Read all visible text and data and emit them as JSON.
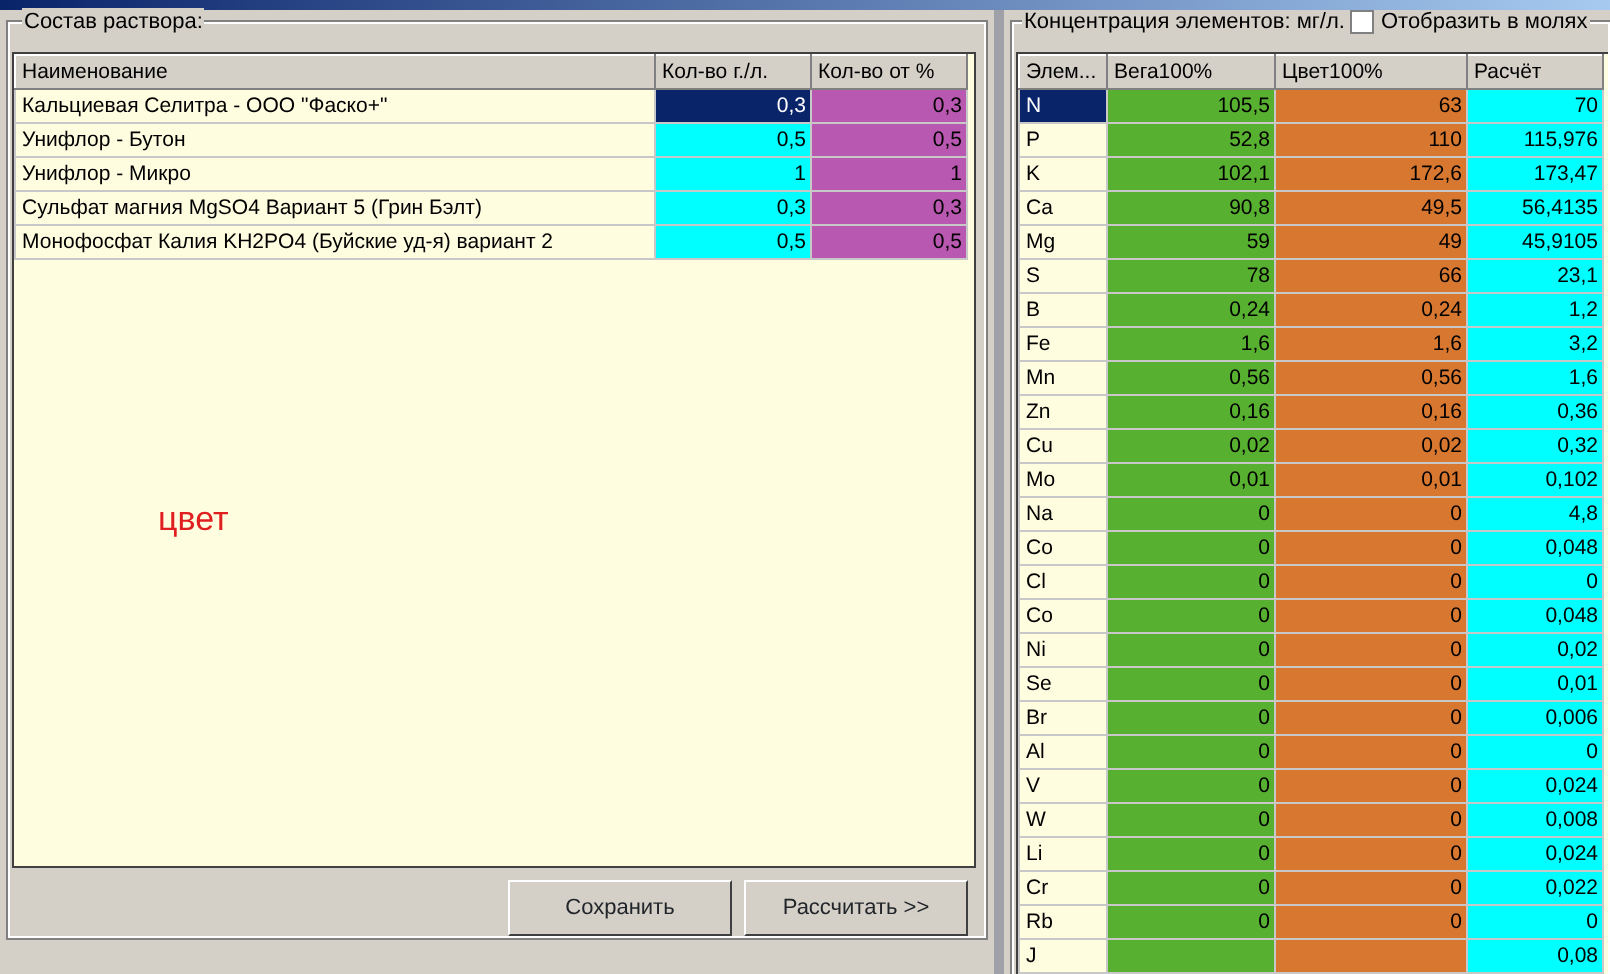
{
  "composition": {
    "title": "Состав раствора:",
    "columns": [
      {
        "label": "Наименование"
      },
      {
        "label": "Кол-во г./л.",
        "color": "#00ffff"
      },
      {
        "label": "Кол-во от %",
        "color": "#b858b0"
      }
    ],
    "rows": [
      {
        "name": "Кальциевая Селитра - ООО \"Фаско+\"",
        "qty": "0,3",
        "pct": "0,3",
        "selected": true
      },
      {
        "name": "Унифлор - Бутон",
        "qty": "0,5",
        "pct": "0,5",
        "selected": false
      },
      {
        "name": "Унифлор - Микро",
        "qty": "1",
        "pct": "1",
        "selected": false
      },
      {
        "name": "Сульфат магния MgSO4 Вариант 5 (Грин Бэлт)",
        "qty": "0,3",
        "pct": "0,3",
        "selected": false
      },
      {
        "name": "Монофосфат Калия KH2PO4 (Буйские уд-я) вариант 2",
        "qty": "0,5",
        "pct": "0,5",
        "selected": false
      }
    ],
    "note": "цвет",
    "buttons": [
      "Сохранить",
      "Рассчитать >>"
    ]
  },
  "concentration": {
    "title": "Концентрация элементов: мг/л.",
    "show_moles": {
      "label": "Отобразить в молях",
      "checked": false
    },
    "columns": [
      {
        "label": "Элем..."
      },
      {
        "label": "Вега100%",
        "color": "#58b030"
      },
      {
        "label": "Цвет100%",
        "color": "#d87830"
      },
      {
        "label": "Расчёт",
        "color": "#00ffff"
      }
    ],
    "rows": [
      {
        "element": "N",
        "vega": "105,5",
        "tsvet": "63",
        "calc": "70",
        "selected": true
      },
      {
        "element": "P",
        "vega": "52,8",
        "tsvet": "110",
        "calc": "115,976",
        "selected": false
      },
      {
        "element": "K",
        "vega": "102,1",
        "tsvet": "172,6",
        "calc": "173,47",
        "selected": false
      },
      {
        "element": "Ca",
        "vega": "90,8",
        "tsvet": "49,5",
        "calc": "56,4135",
        "selected": false
      },
      {
        "element": "Mg",
        "vega": "59",
        "tsvet": "49",
        "calc": "45,9105",
        "selected": false
      },
      {
        "element": "S",
        "vega": "78",
        "tsvet": "66",
        "calc": "23,1",
        "selected": false
      },
      {
        "element": "B",
        "vega": "0,24",
        "tsvet": "0,24",
        "calc": "1,2",
        "selected": false
      },
      {
        "element": "Fe",
        "vega": "1,6",
        "tsvet": "1,6",
        "calc": "3,2",
        "selected": false
      },
      {
        "element": "Mn",
        "vega": "0,56",
        "tsvet": "0,56",
        "calc": "1,6",
        "selected": false
      },
      {
        "element": "Zn",
        "vega": "0,16",
        "tsvet": "0,16",
        "calc": "0,36",
        "selected": false
      },
      {
        "element": "Cu",
        "vega": "0,02",
        "tsvet": "0,02",
        "calc": "0,32",
        "selected": false
      },
      {
        "element": "Mo",
        "vega": "0,01",
        "tsvet": "0,01",
        "calc": "0,102",
        "selected": false
      },
      {
        "element": "Na",
        "vega": "0",
        "tsvet": "0",
        "calc": "4,8",
        "selected": false
      },
      {
        "element": "Co",
        "vega": "0",
        "tsvet": "0",
        "calc": "0,048",
        "selected": false
      },
      {
        "element": "Cl",
        "vega": "0",
        "tsvet": "0",
        "calc": "0",
        "selected": false
      },
      {
        "element": "Co",
        "vega": "0",
        "tsvet": "0",
        "calc": "0,048",
        "selected": false
      },
      {
        "element": "Ni",
        "vega": "0",
        "tsvet": "0",
        "calc": "0,02",
        "selected": false
      },
      {
        "element": "Se",
        "vega": "0",
        "tsvet": "0",
        "calc": "0,01",
        "selected": false
      },
      {
        "element": "Br",
        "vega": "0",
        "tsvet": "0",
        "calc": "0,006",
        "selected": false
      },
      {
        "element": "Al",
        "vega": "0",
        "tsvet": "0",
        "calc": "0",
        "selected": false
      },
      {
        "element": "V",
        "vega": "0",
        "tsvet": "0",
        "calc": "0,024",
        "selected": false
      },
      {
        "element": "W",
        "vega": "0",
        "tsvet": "0",
        "calc": "0,008",
        "selected": false
      },
      {
        "element": "Li",
        "vega": "0",
        "tsvet": "0",
        "calc": "0,024",
        "selected": false
      },
      {
        "element": "Cr",
        "vega": "0",
        "tsvet": "0",
        "calc": "0,022",
        "selected": false
      },
      {
        "element": "Rb",
        "vega": "0",
        "tsvet": "0",
        "calc": "0",
        "selected": false
      },
      {
        "element": "J",
        "calc": "0,08",
        "selected": false
      }
    ]
  }
}
